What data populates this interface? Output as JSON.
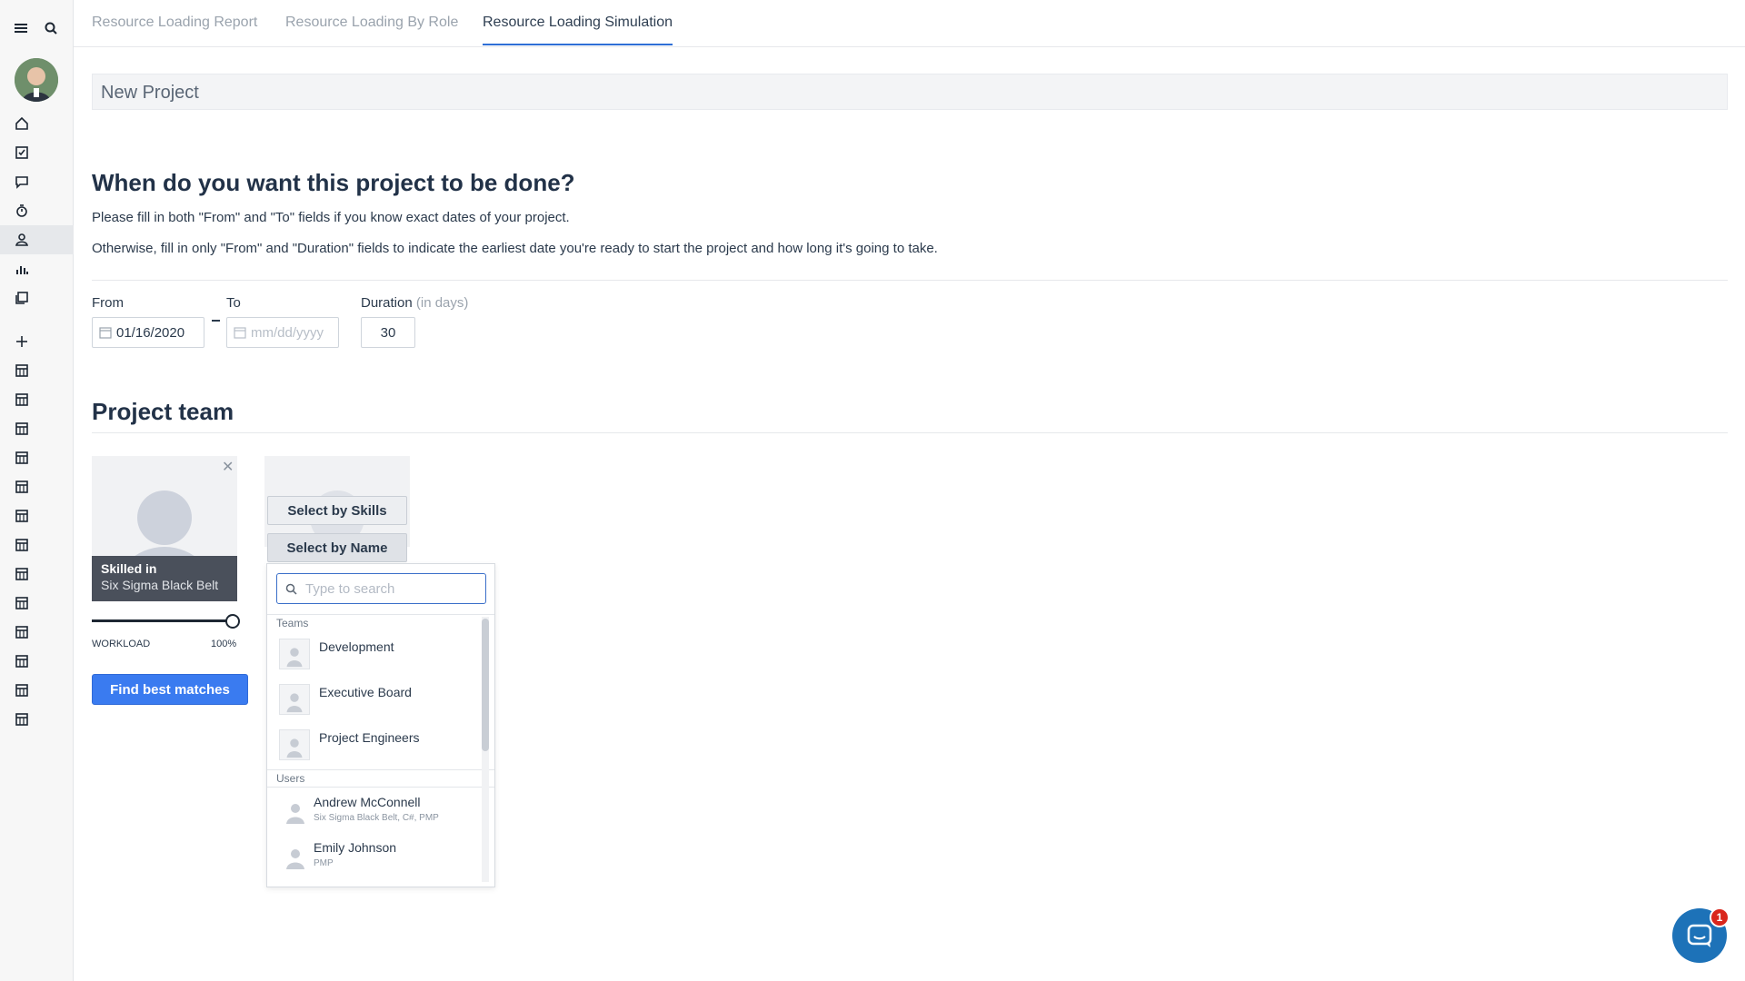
{
  "tabs": [
    {
      "label": "Resource Loading Report"
    },
    {
      "label": "Resource Loading By Role"
    },
    {
      "label": "Resource Loading Simulation"
    }
  ],
  "project": {
    "name": "New Project"
  },
  "schedule": {
    "heading": "When do you want this project to be done?",
    "hint1": "Please fill in both \"From\" and \"To\" fields if you know exact dates of your project.",
    "hint2": "Otherwise, fill in only \"From\" and \"Duration\" fields to indicate the earliest date you're ready to start the project and how long it's going to take.",
    "from_label": "From",
    "from_value": "01/16/2020",
    "to_label": "To",
    "to_placeholder": "mm/dd/yyyy",
    "duration_label": "Duration",
    "duration_unit": "(in days)",
    "duration_value": "30"
  },
  "team": {
    "heading": "Project team",
    "member": {
      "skilled_title": "Skilled in",
      "skill": "Six Sigma Black Belt",
      "workload_label": "WORKLOAD",
      "workload_value": "100%",
      "workload_fraction": 1.0
    },
    "find_button": "Find best matches",
    "select_by_skills": "Select by Skills",
    "select_by_name": "Select by Name",
    "dropdown": {
      "search_placeholder": "Type to search",
      "teams_label": "Teams",
      "teams": [
        "Development",
        "Executive Board",
        "Project Engineers"
      ],
      "users_label": "Users",
      "users": [
        {
          "name": "Andrew McConnell",
          "skills": "Six Sigma Black Belt, C#, PMP"
        },
        {
          "name": "Emily Johnson",
          "skills": "PMP"
        }
      ]
    }
  },
  "chat": {
    "badge": "1"
  },
  "colors": {
    "accent": "#3a7bf0",
    "tab_active_underline": "#2f6fd6",
    "badge": "#d9261c"
  }
}
